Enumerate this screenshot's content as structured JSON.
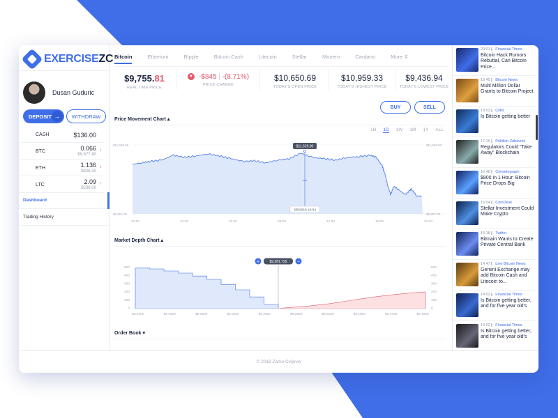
{
  "brand": {
    "logo_main": "EXERCISE",
    "logo_accent": "ZC"
  },
  "user": {
    "name": "Dusan Guduric"
  },
  "actions": {
    "deposit": "DEPOSIT",
    "withdraw": "WITHDRAW",
    "buy": "BUY",
    "sell": "SELL"
  },
  "assets": [
    {
      "symbol": "CASH",
      "amount": "$136.00",
      "value": "",
      "trend": ""
    },
    {
      "symbol": "BTC",
      "amount": "0.066",
      "value": "$9,677.80",
      "trend": "↓"
    },
    {
      "symbol": "ETH",
      "amount": "1.136",
      "value": "$826.30",
      "trend": "↓"
    },
    {
      "symbol": "LTC",
      "amount": "2.09",
      "value": "$238.00",
      "trend": "↑"
    }
  ],
  "nav": [
    {
      "label": "Dashboard"
    },
    {
      "label": "Trading History"
    }
  ],
  "tabs": [
    "Bitcoin",
    "Etherium",
    "Ripple",
    "Bitcoin Cash",
    "Litecoin",
    "Stellar",
    "Monero",
    "Cardano",
    "More"
  ],
  "stats": {
    "price_main": "$9,755.",
    "price_cents": "81",
    "price_label": "REAL TIME PRICE",
    "change_abs": "-$845",
    "change_pct": "-(8.71%)",
    "change_label": "PRICE CHANGE",
    "open": "$10,650.69",
    "open_label": "TODAY'S OPEN PRICE",
    "high": "$10,959.33",
    "high_label": "TODAY'S HIGHEST PRICE",
    "low": "$9,436.94",
    "low_label": "TODAY'S LOWEST PRICE"
  },
  "price_chart": {
    "title": "Price Movement Chart",
    "timeframes": [
      "1H",
      "1D",
      "1W",
      "1M",
      "1Y",
      "ALL"
    ],
    "active_timeframe": "1D",
    "y_top": "$11,629.00",
    "y_bottom": "$9,557.00",
    "x_labels": [
      "21:00",
      "24:00",
      "03:00",
      "06:00",
      "12:00",
      "16:00",
      "21:00"
    ],
    "tooltip_value": "$11,629.00",
    "tooltip_date": "3/8/2018 10:34"
  },
  "depth_chart": {
    "title": "Market Depth Chart",
    "y_labels": [
      "500",
      "400",
      "300",
      "200",
      "100",
      "0"
    ],
    "x_labels": [
      "$9.4600",
      "$9.4500",
      "$9.3800",
      "$9.3400",
      "$9.3000",
      "$9.2600",
      "$9.2200",
      "$9.1800",
      "$9.1400",
      "$9.1000"
    ],
    "tooltip_value": "$9,281.725",
    "plus": "+",
    "minus": "−"
  },
  "order_book": {
    "title": "Order Book"
  },
  "news": [
    {
      "time": "20:01",
      "source": "Financial Times",
      "title": "Bitcoin Hack Rumors Rebuttal, Can Bitcoin Price..."
    },
    {
      "time": "19:45",
      "source": "Bitcoin News",
      "title": "Multi Million Dollar Grants to Bitcoin Project"
    },
    {
      "time": "19:03",
      "source": "CNN",
      "title": "Is Bitcoin getting better"
    },
    {
      "time": "17:16",
      "source": "Politikin Zabavnik",
      "title": "Regulators Could \"Take Away\" Blockchain"
    },
    {
      "time": "16:48",
      "source": "Cointelegraph",
      "title": "$800 in 1 Hour: Bitcoin Price Drops Big"
    },
    {
      "time": "16:04",
      "source": "CoinDesk",
      "title": "Stellar Investment Could Make Crypto"
    },
    {
      "time": "15:18",
      "source": "Twitter",
      "title": "Bitmain Wants to Create Private Central Bank"
    },
    {
      "time": "14:47",
      "source": "Live Bitcoin News",
      "title": "Gemini Exchange may add Bitcoin Cash and Litecoin to..."
    },
    {
      "time": "14:02",
      "source": "Financial Times",
      "title": "Is Bitcoin getting better, and for five year old's"
    },
    {
      "time": "14:02",
      "source": "Financial Times",
      "title": "Is Bitcoin getting better, and for five year old's"
    }
  ],
  "footer": "© 2018 Zarko Cvijovic",
  "colors": {
    "accent": "#3f6ee8",
    "negative": "#e15b6a",
    "positive": "#3bb36b",
    "bid_fill": "#dfe9fb",
    "ask_fill": "#fde0e2"
  }
}
